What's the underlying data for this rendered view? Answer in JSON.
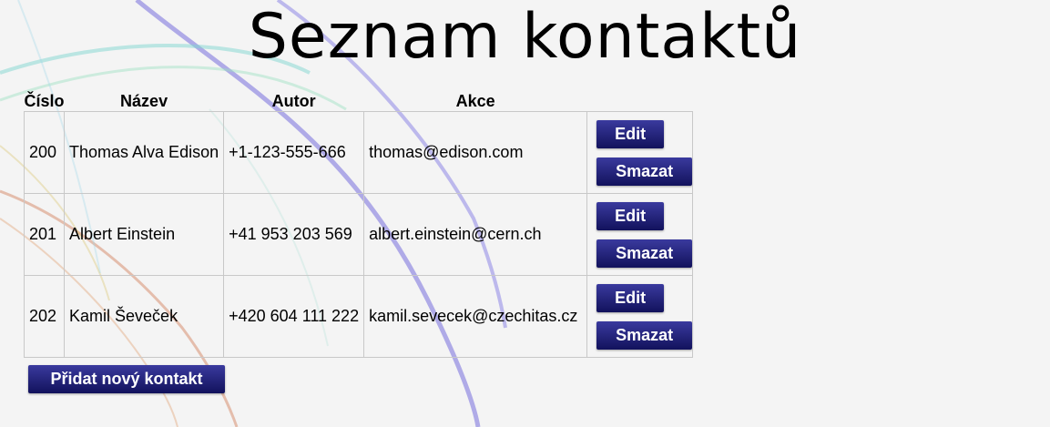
{
  "page": {
    "title": "Seznam kontaktů"
  },
  "table": {
    "headers": {
      "number": "Číslo",
      "name": "Název",
      "author": "Autor",
      "actions": "Akce"
    },
    "rows": [
      {
        "number": "200",
        "name": "Thomas Alva Edison",
        "phone": "+1-123-555-666",
        "email": "thomas@edison.com"
      },
      {
        "number": "201",
        "name": "Albert Einstein",
        "phone": "+41 953 203 569",
        "email": "albert.einstein@cern.ch"
      },
      {
        "number": "202",
        "name": "Kamil Ševeček",
        "phone": "+420 604 111 222",
        "email": "kamil.sevecek@czechitas.cz"
      }
    ],
    "edit_label": "Edit",
    "delete_label": "Smazat"
  },
  "add_button": {
    "label": "Přidat nový kontakt"
  },
  "colors": {
    "background": "#f4f4f4",
    "button_top": "#3a3a9e",
    "button_bottom": "#12125c",
    "button_text": "#ffffff",
    "border": "#c8c8c8"
  }
}
